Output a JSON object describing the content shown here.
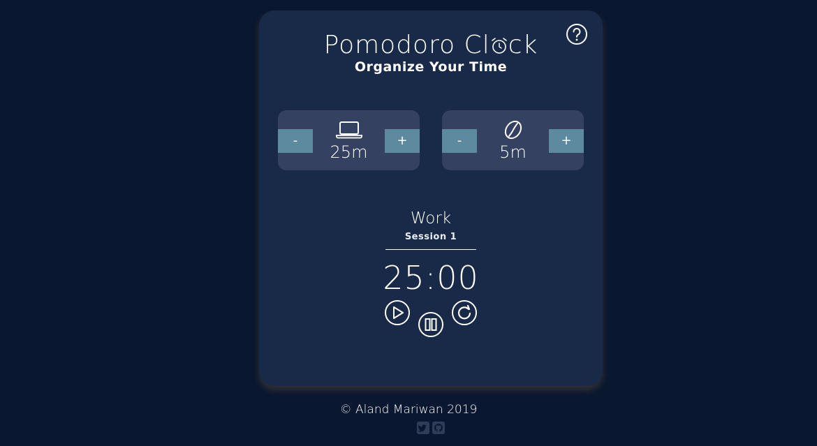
{
  "app": {
    "title_prefix": "Pomodoro Cl",
    "title_suffix": "ck",
    "subtitle": "Organize Your Time"
  },
  "work": {
    "minus_label": "-",
    "plus_label": "+",
    "value": "25m",
    "icon": "laptop-icon"
  },
  "break": {
    "minus_label": "-",
    "plus_label": "+",
    "value": "5m",
    "icon": "coffee-bean-icon"
  },
  "status": {
    "mode": "Work",
    "session": "Session 1",
    "time": "25:00"
  },
  "controls": {
    "icons": [
      "play-icon",
      "pause-icon",
      "reset-icon",
      "help-icon"
    ]
  },
  "footer": {
    "copyright": "© Aland Mariwan 2019",
    "social_icons": [
      "twitter-icon",
      "github-icon"
    ]
  },
  "colors": {
    "background": "#0a1730",
    "card": "#182a48",
    "setter_panel": "#354160",
    "adjust_button": "#5e8aa0",
    "foreground": "#ffffff"
  }
}
